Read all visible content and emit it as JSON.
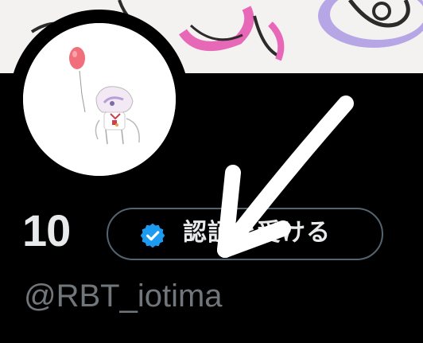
{
  "profile": {
    "display_name": "10",
    "handle": "@RBT_iotima"
  },
  "verify_button": {
    "label": "認証を受ける",
    "badge_color": "#1d9bf0"
  },
  "colors": {
    "background": "#000000",
    "text_primary": "#e7e9ea",
    "text_secondary": "#71767b",
    "button_border": "#536471",
    "annotation": "#ffffff"
  },
  "icons": {
    "badge": "verified-badge-icon",
    "annotation": "arrow-annotation"
  }
}
